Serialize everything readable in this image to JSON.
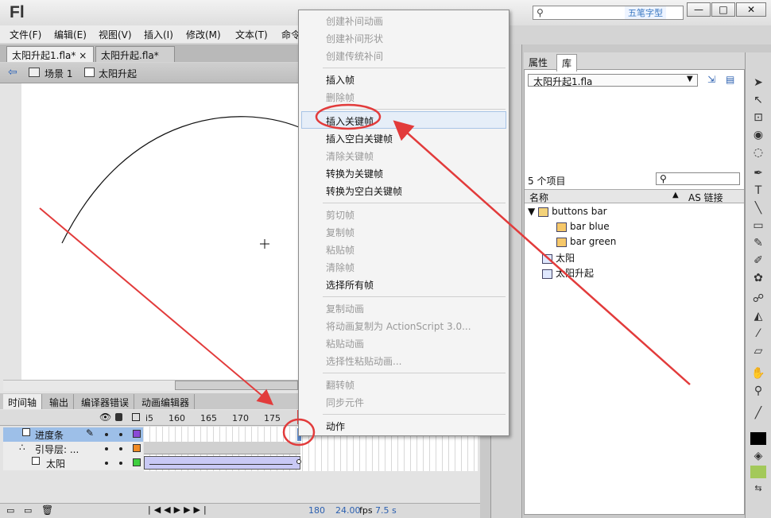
{
  "app": {
    "logo": "Fl"
  },
  "search": {
    "watermark": "五笔字型"
  },
  "window_controls": {
    "min": "—",
    "max": "□",
    "close": "✕"
  },
  "menu": [
    "文件(F)",
    "编辑(E)",
    "视图(V)",
    "插入(I)",
    "修改(M)",
    "文本(T)",
    "命令"
  ],
  "doc_tabs": [
    {
      "label": "太阳升起1.fla*"
    },
    {
      "label": "太阳升起.fla*"
    }
  ],
  "tab_close": "×",
  "scene": {
    "label": "场景 1",
    "symbol": "太阳升起"
  },
  "timeline": {
    "tabs": [
      "时间轴",
      "输出",
      "编译器错误",
      "动画编辑器"
    ],
    "ruler": [
      "i5",
      "160",
      "165",
      "170",
      "175"
    ],
    "layers": [
      {
        "name": "进度条"
      },
      {
        "name": "引导层: ..."
      },
      {
        "name": "太阳"
      }
    ],
    "status": {
      "frame": "180",
      "fps": "24.00",
      "fps_unit": "fps",
      "time": "7.5 s"
    }
  },
  "context_menu": {
    "items": [
      {
        "label": "创建补间动画",
        "enabled": false
      },
      {
        "label": "创建补间形状",
        "enabled": false
      },
      {
        "label": "创建传统补间",
        "enabled": false
      },
      {
        "label": "插入帧",
        "enabled": true
      },
      {
        "label": "删除帧",
        "enabled": false
      },
      {
        "label": "插入关键帧",
        "enabled": true
      },
      {
        "label": "插入空白关键帧",
        "enabled": true
      },
      {
        "label": "清除关键帧",
        "enabled": false
      },
      {
        "label": "转换为关键帧",
        "enabled": true
      },
      {
        "label": "转换为空白关键帧",
        "enabled": true
      },
      {
        "label": "剪切帧",
        "enabled": false
      },
      {
        "label": "复制帧",
        "enabled": false
      },
      {
        "label": "粘贴帧",
        "enabled": false
      },
      {
        "label": "清除帧",
        "enabled": false
      },
      {
        "label": "选择所有帧",
        "enabled": true
      },
      {
        "label": "复制动画",
        "enabled": false
      },
      {
        "label": "将动画复制为 ActionScript 3.0...",
        "enabled": false
      },
      {
        "label": "粘贴动画",
        "enabled": false
      },
      {
        "label": "选择性粘贴动画...",
        "enabled": false
      },
      {
        "label": "翻转帧",
        "enabled": false
      },
      {
        "label": "同步元件",
        "enabled": false
      },
      {
        "label": "动作",
        "enabled": true
      }
    ]
  },
  "library": {
    "tabs": [
      "属性",
      "库"
    ],
    "file": "太阳升起1.fla",
    "count": "5 个项目",
    "col_name": "名称",
    "col_linkage": "AS 链接",
    "items": [
      {
        "label": "buttons bar",
        "type": "folder"
      },
      {
        "label": "bar blue",
        "type": "button"
      },
      {
        "label": "bar green",
        "type": "button"
      },
      {
        "label": "太阳",
        "type": "graphic"
      },
      {
        "label": "太阳升起",
        "type": "graphic"
      }
    ]
  },
  "colors": {
    "annotation": "#e23b3b",
    "selection": "#9dbfe8",
    "tween": "#c9c9f5"
  }
}
